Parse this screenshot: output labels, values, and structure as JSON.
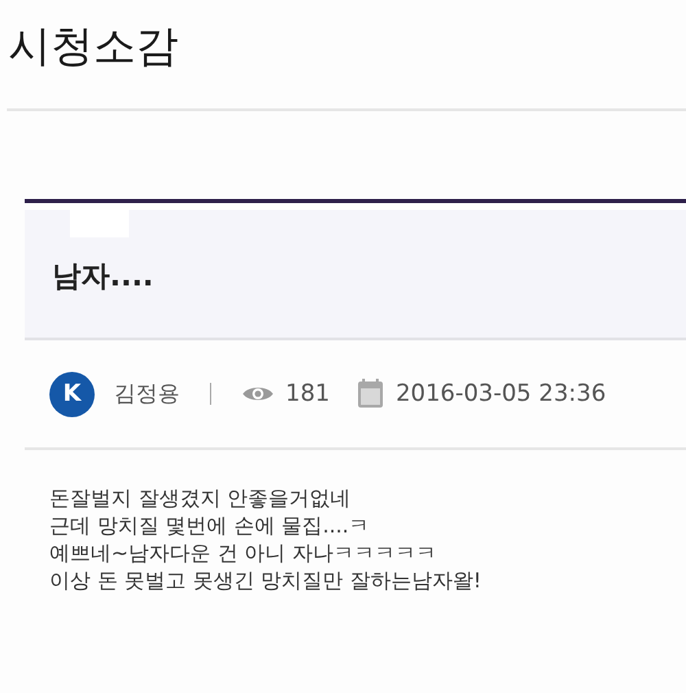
{
  "page_title": "시청소감",
  "post": {
    "title": "남자....",
    "author_initial": "K",
    "author": "김정용",
    "views": "181",
    "date": "2016-03-05 23:36",
    "body": [
      "돈잘벌지 잘생겼지 안좋을거없네",
      "근데 망치질 몇번에 손에 물집....ㅋ",
      "예쁘네~남자다운 건 아니 자나ㅋㅋㅋㅋㅋ",
      "이상 돈 못벌고 못생긴 망치질만 잘하는남자왈!"
    ]
  }
}
